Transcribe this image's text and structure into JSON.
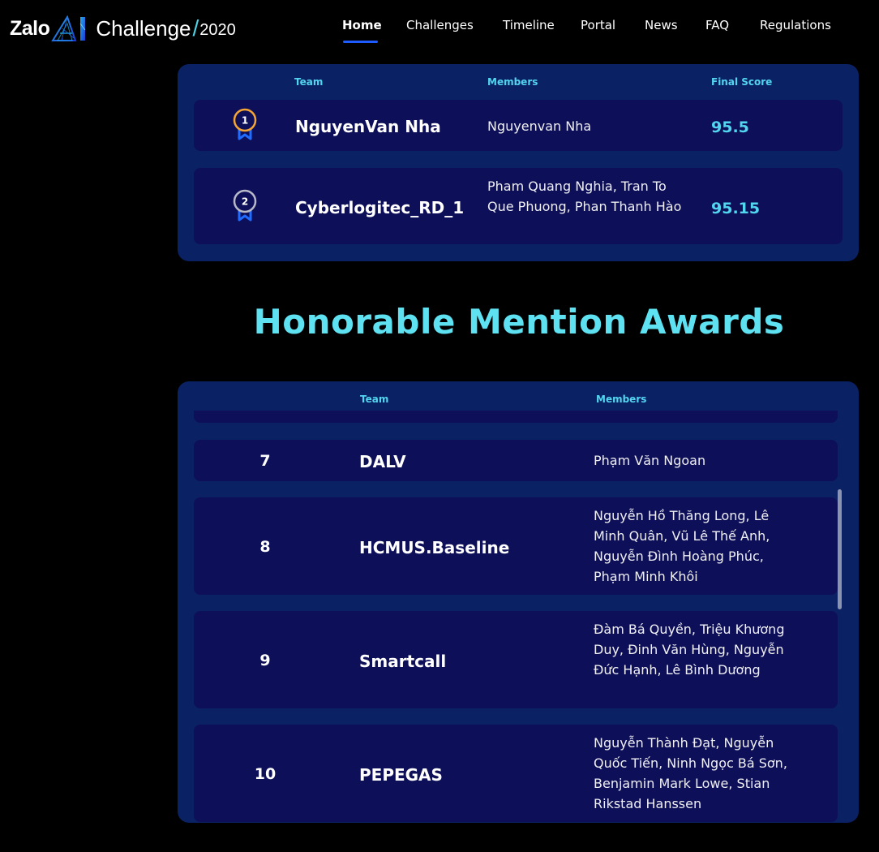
{
  "brand": {
    "zalo": "Zalo",
    "ai_logo": "AI",
    "challenge": "Challenge",
    "slash": "/",
    "year": "2020"
  },
  "nav": [
    {
      "label": "Home",
      "active": true
    },
    {
      "label": "Challenges",
      "active": false
    },
    {
      "label": "Timeline",
      "active": false
    },
    {
      "label": "Portal",
      "active": false
    },
    {
      "label": "News",
      "active": false
    },
    {
      "label": "FAQ",
      "active": false
    },
    {
      "label": "Regulations",
      "active": false
    }
  ],
  "top_table": {
    "headers": {
      "team": "Team",
      "members": "Members",
      "score": "Final Score"
    },
    "rows": [
      {
        "rank": "1",
        "medal_color": "#f4a533",
        "team": "NguyenVan Nha",
        "members": "Nguyenvan Nha",
        "score": "95.5"
      },
      {
        "rank": "2",
        "medal_color": "#b7b9c9",
        "team": "Cyberlogitec_RD_1",
        "members": "Pham Quang Nghia, Tran To Que Phuong, Phan Thanh Hào",
        "score": "95.15"
      }
    ]
  },
  "honorable": {
    "title": "Honorable Mention Awards",
    "headers": {
      "team": "Team",
      "members": "Members"
    },
    "rows": [
      {
        "rank": "7",
        "team": "DALV",
        "members": "Phạm Văn Ngoan"
      },
      {
        "rank": "8",
        "team": "HCMUS.Baseline",
        "members": "Nguyễn Hồ Thăng Long, Lê Minh Quân, Vũ Lê Thế Anh, Nguyễn Đình Hoàng Phúc, Phạm Minh Khôi"
      },
      {
        "rank": "9",
        "team": "Smartcall",
        "members": "Đàm Bá Quyền, Triệu Khương Duy, Đinh Văn Hùng, Nguyễn Đức Hạnh, Lê Bình Dương"
      },
      {
        "rank": "10",
        "team": "PEPEGAS",
        "members": "Nguyễn Thành Đạt, Nguyễn Quốc Tiến, Ninh Ngọc Bá Sơn, Benjamin Mark Lowe, Stian Rikstad Hanssen"
      }
    ]
  },
  "colors": {
    "background": "#000000",
    "card": "#0a2163",
    "row": "#0d0f58",
    "accent": "#52d6f0",
    "nav_underline": "#1f5cff"
  },
  "icons": {
    "medal": "ribbon-medal-icon"
  }
}
